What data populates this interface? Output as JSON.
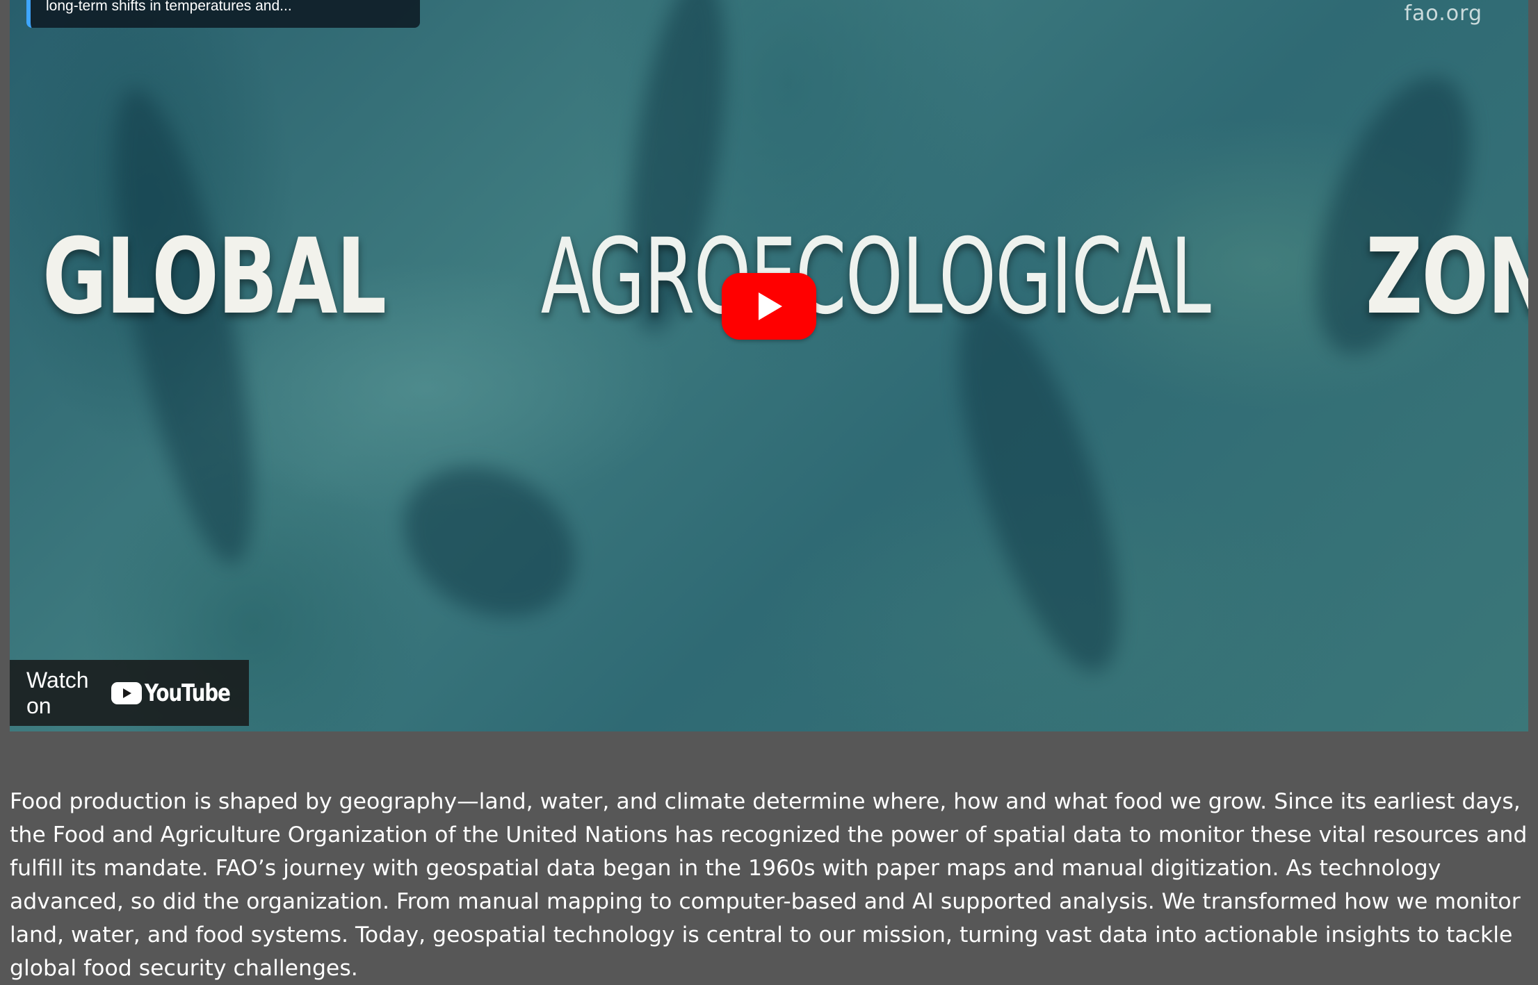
{
  "video": {
    "info_card_text": "long-term shifts in temperatures and...",
    "channel_logo_text": "fao.org",
    "title_part_1": "GLOBAL",
    "title_part_2": "AGROECOLOGICAL",
    "title_part_3": "ZONING",
    "play_button_icon": "play-icon",
    "watch_on_label": "Watch on",
    "youtube_wordmark": "YouTube",
    "colors": {
      "play_button": "#ff0000",
      "info_card_accent": "#3ea6ff"
    }
  },
  "article": {
    "paragraph": "Food production is shaped by geography—land, water, and climate determine where, how and what food we grow. Since its earliest days, the Food and Agriculture Organization of the United Nations has recognized the power of spatial data to monitor these vital resources and fulfill its mandate. FAO’s journey with geospatial data began in the 1960s with paper maps and manual digitization. As technology advanced, so did the organization. From manual mapping to computer-based and AI supported analysis. We transformed how we monitor land, water, and food systems. Today, geospatial technology is central to our mission, turning vast data into actionable insights to tackle global food security challenges."
  }
}
